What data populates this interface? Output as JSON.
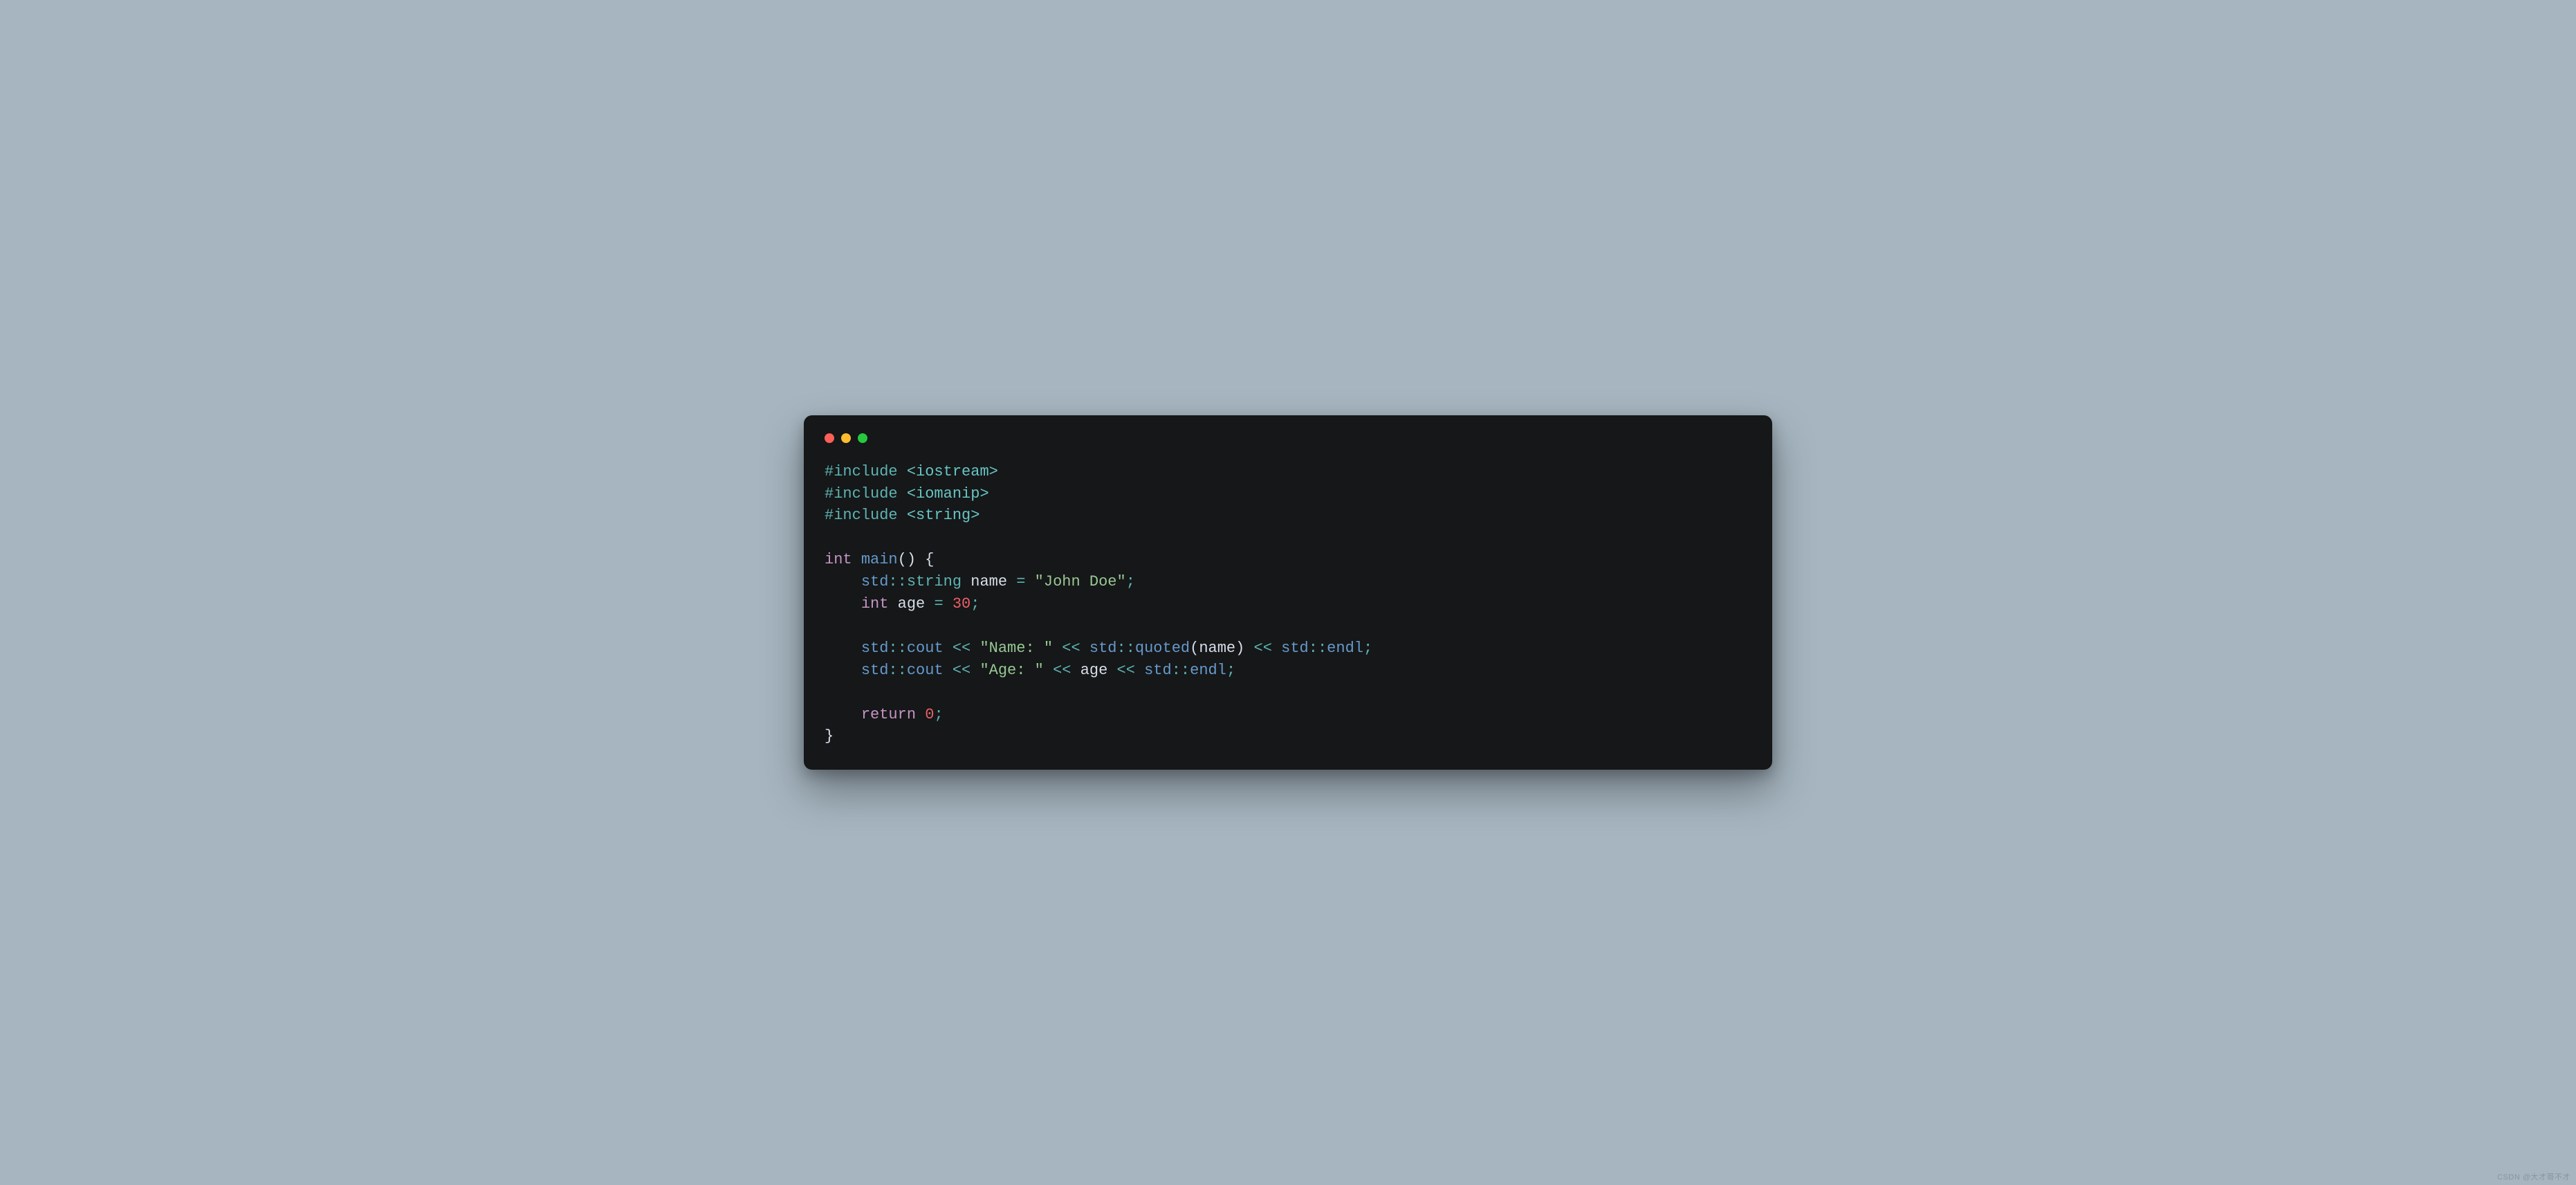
{
  "window": {
    "traffic_lights": {
      "red": "#ff5f56",
      "yellow": "#ffbd2e",
      "green": "#27c93f"
    }
  },
  "code": {
    "lines": [
      {
        "indent": 0,
        "tokens": [
          {
            "t": "#include ",
            "c": "c-pre"
          },
          {
            "t": "<iostream>",
            "c": "c-inc"
          }
        ]
      },
      {
        "indent": 0,
        "tokens": [
          {
            "t": "#include ",
            "c": "c-pre"
          },
          {
            "t": "<iomanip>",
            "c": "c-inc"
          }
        ]
      },
      {
        "indent": 0,
        "tokens": [
          {
            "t": "#include ",
            "c": "c-pre"
          },
          {
            "t": "<string>",
            "c": "c-inc"
          }
        ]
      },
      {
        "indent": 0,
        "tokens": []
      },
      {
        "indent": 0,
        "tokens": [
          {
            "t": "int",
            "c": "c-kw"
          },
          {
            "t": " ",
            "c": ""
          },
          {
            "t": "main",
            "c": "c-fn"
          },
          {
            "t": "()",
            "c": "c-punc"
          },
          {
            "t": " ",
            "c": ""
          },
          {
            "t": "{",
            "c": "c-punc"
          }
        ]
      },
      {
        "indent": 1,
        "tokens": [
          {
            "t": "std",
            "c": "c-ns"
          },
          {
            "t": "::",
            "c": "c-op"
          },
          {
            "t": "string",
            "c": "c-type"
          },
          {
            "t": " ",
            "c": ""
          },
          {
            "t": "name",
            "c": "c-var"
          },
          {
            "t": " ",
            "c": ""
          },
          {
            "t": "=",
            "c": "c-op"
          },
          {
            "t": " ",
            "c": ""
          },
          {
            "t": "\"John Doe\"",
            "c": "c-str"
          },
          {
            "t": ";",
            "c": "c-op"
          }
        ]
      },
      {
        "indent": 1,
        "tokens": [
          {
            "t": "int",
            "c": "c-kw"
          },
          {
            "t": " ",
            "c": ""
          },
          {
            "t": "age",
            "c": "c-var"
          },
          {
            "t": " ",
            "c": ""
          },
          {
            "t": "=",
            "c": "c-op"
          },
          {
            "t": " ",
            "c": ""
          },
          {
            "t": "30",
            "c": "c-num"
          },
          {
            "t": ";",
            "c": "c-op"
          }
        ]
      },
      {
        "indent": 0,
        "tokens": []
      },
      {
        "indent": 1,
        "tokens": [
          {
            "t": "std",
            "c": "c-ns"
          },
          {
            "t": "::",
            "c": "c-op"
          },
          {
            "t": "cout",
            "c": "c-mem"
          },
          {
            "t": " ",
            "c": ""
          },
          {
            "t": "<<",
            "c": "c-op"
          },
          {
            "t": " ",
            "c": ""
          },
          {
            "t": "\"Name: \"",
            "c": "c-str"
          },
          {
            "t": " ",
            "c": ""
          },
          {
            "t": "<<",
            "c": "c-op"
          },
          {
            "t": " ",
            "c": ""
          },
          {
            "t": "std",
            "c": "c-ns"
          },
          {
            "t": "::",
            "c": "c-op"
          },
          {
            "t": "quoted",
            "c": "c-fn"
          },
          {
            "t": "(",
            "c": "c-punc"
          },
          {
            "t": "name",
            "c": "c-var"
          },
          {
            "t": ")",
            "c": "c-punc"
          },
          {
            "t": " ",
            "c": ""
          },
          {
            "t": "<<",
            "c": "c-op"
          },
          {
            "t": " ",
            "c": ""
          },
          {
            "t": "std",
            "c": "c-ns"
          },
          {
            "t": "::",
            "c": "c-op"
          },
          {
            "t": "endl",
            "c": "c-mem"
          },
          {
            "t": ";",
            "c": "c-op"
          }
        ]
      },
      {
        "indent": 1,
        "tokens": [
          {
            "t": "std",
            "c": "c-ns"
          },
          {
            "t": "::",
            "c": "c-op"
          },
          {
            "t": "cout",
            "c": "c-mem"
          },
          {
            "t": " ",
            "c": ""
          },
          {
            "t": "<<",
            "c": "c-op"
          },
          {
            "t": " ",
            "c": ""
          },
          {
            "t": "\"Age: \"",
            "c": "c-str"
          },
          {
            "t": " ",
            "c": ""
          },
          {
            "t": "<<",
            "c": "c-op"
          },
          {
            "t": " ",
            "c": ""
          },
          {
            "t": "age",
            "c": "c-var"
          },
          {
            "t": " ",
            "c": ""
          },
          {
            "t": "<<",
            "c": "c-op"
          },
          {
            "t": " ",
            "c": ""
          },
          {
            "t": "std",
            "c": "c-ns"
          },
          {
            "t": "::",
            "c": "c-op"
          },
          {
            "t": "endl",
            "c": "c-mem"
          },
          {
            "t": ";",
            "c": "c-op"
          }
        ]
      },
      {
        "indent": 0,
        "tokens": []
      },
      {
        "indent": 1,
        "tokens": [
          {
            "t": "return",
            "c": "c-kw"
          },
          {
            "t": " ",
            "c": ""
          },
          {
            "t": "0",
            "c": "c-num"
          },
          {
            "t": ";",
            "c": "c-op"
          }
        ]
      },
      {
        "indent": 0,
        "tokens": [
          {
            "t": "}",
            "c": "c-punc"
          }
        ]
      }
    ]
  },
  "watermark": "CSDN @大才哥不才"
}
